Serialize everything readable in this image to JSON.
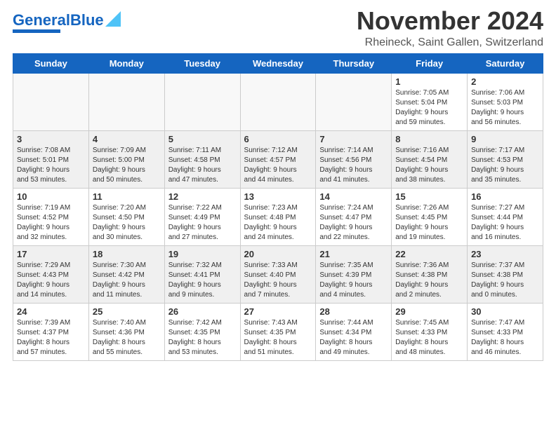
{
  "logo": {
    "text_general": "General",
    "text_blue": "Blue"
  },
  "header": {
    "month": "November 2024",
    "location": "Rheineck, Saint Gallen, Switzerland"
  },
  "weekdays": [
    "Sunday",
    "Monday",
    "Tuesday",
    "Wednesday",
    "Thursday",
    "Friday",
    "Saturday"
  ],
  "weeks": [
    [
      {
        "day": "",
        "info": "",
        "empty": true
      },
      {
        "day": "",
        "info": "",
        "empty": true
      },
      {
        "day": "",
        "info": "",
        "empty": true
      },
      {
        "day": "",
        "info": "",
        "empty": true
      },
      {
        "day": "",
        "info": "",
        "empty": true
      },
      {
        "day": "1",
        "info": "Sunrise: 7:05 AM\nSunset: 5:04 PM\nDaylight: 9 hours\nand 59 minutes."
      },
      {
        "day": "2",
        "info": "Sunrise: 7:06 AM\nSunset: 5:03 PM\nDaylight: 9 hours\nand 56 minutes."
      }
    ],
    [
      {
        "day": "3",
        "info": "Sunrise: 7:08 AM\nSunset: 5:01 PM\nDaylight: 9 hours\nand 53 minutes."
      },
      {
        "day": "4",
        "info": "Sunrise: 7:09 AM\nSunset: 5:00 PM\nDaylight: 9 hours\nand 50 minutes."
      },
      {
        "day": "5",
        "info": "Sunrise: 7:11 AM\nSunset: 4:58 PM\nDaylight: 9 hours\nand 47 minutes."
      },
      {
        "day": "6",
        "info": "Sunrise: 7:12 AM\nSunset: 4:57 PM\nDaylight: 9 hours\nand 44 minutes."
      },
      {
        "day": "7",
        "info": "Sunrise: 7:14 AM\nSunset: 4:56 PM\nDaylight: 9 hours\nand 41 minutes."
      },
      {
        "day": "8",
        "info": "Sunrise: 7:16 AM\nSunset: 4:54 PM\nDaylight: 9 hours\nand 38 minutes."
      },
      {
        "day": "9",
        "info": "Sunrise: 7:17 AM\nSunset: 4:53 PM\nDaylight: 9 hours\nand 35 minutes."
      }
    ],
    [
      {
        "day": "10",
        "info": "Sunrise: 7:19 AM\nSunset: 4:52 PM\nDaylight: 9 hours\nand 32 minutes."
      },
      {
        "day": "11",
        "info": "Sunrise: 7:20 AM\nSunset: 4:50 PM\nDaylight: 9 hours\nand 30 minutes."
      },
      {
        "day": "12",
        "info": "Sunrise: 7:22 AM\nSunset: 4:49 PM\nDaylight: 9 hours\nand 27 minutes."
      },
      {
        "day": "13",
        "info": "Sunrise: 7:23 AM\nSunset: 4:48 PM\nDaylight: 9 hours\nand 24 minutes."
      },
      {
        "day": "14",
        "info": "Sunrise: 7:24 AM\nSunset: 4:47 PM\nDaylight: 9 hours\nand 22 minutes."
      },
      {
        "day": "15",
        "info": "Sunrise: 7:26 AM\nSunset: 4:45 PM\nDaylight: 9 hours\nand 19 minutes."
      },
      {
        "day": "16",
        "info": "Sunrise: 7:27 AM\nSunset: 4:44 PM\nDaylight: 9 hours\nand 16 minutes."
      }
    ],
    [
      {
        "day": "17",
        "info": "Sunrise: 7:29 AM\nSunset: 4:43 PM\nDaylight: 9 hours\nand 14 minutes."
      },
      {
        "day": "18",
        "info": "Sunrise: 7:30 AM\nSunset: 4:42 PM\nDaylight: 9 hours\nand 11 minutes."
      },
      {
        "day": "19",
        "info": "Sunrise: 7:32 AM\nSunset: 4:41 PM\nDaylight: 9 hours\nand 9 minutes."
      },
      {
        "day": "20",
        "info": "Sunrise: 7:33 AM\nSunset: 4:40 PM\nDaylight: 9 hours\nand 7 minutes."
      },
      {
        "day": "21",
        "info": "Sunrise: 7:35 AM\nSunset: 4:39 PM\nDaylight: 9 hours\nand 4 minutes."
      },
      {
        "day": "22",
        "info": "Sunrise: 7:36 AM\nSunset: 4:38 PM\nDaylight: 9 hours\nand 2 minutes."
      },
      {
        "day": "23",
        "info": "Sunrise: 7:37 AM\nSunset: 4:38 PM\nDaylight: 9 hours\nand 0 minutes."
      }
    ],
    [
      {
        "day": "24",
        "info": "Sunrise: 7:39 AM\nSunset: 4:37 PM\nDaylight: 8 hours\nand 57 minutes."
      },
      {
        "day": "25",
        "info": "Sunrise: 7:40 AM\nSunset: 4:36 PM\nDaylight: 8 hours\nand 55 minutes."
      },
      {
        "day": "26",
        "info": "Sunrise: 7:42 AM\nSunset: 4:35 PM\nDaylight: 8 hours\nand 53 minutes."
      },
      {
        "day": "27",
        "info": "Sunrise: 7:43 AM\nSunset: 4:35 PM\nDaylight: 8 hours\nand 51 minutes."
      },
      {
        "day": "28",
        "info": "Sunrise: 7:44 AM\nSunset: 4:34 PM\nDaylight: 8 hours\nand 49 minutes."
      },
      {
        "day": "29",
        "info": "Sunrise: 7:45 AM\nSunset: 4:33 PM\nDaylight: 8 hours\nand 48 minutes."
      },
      {
        "day": "30",
        "info": "Sunrise: 7:47 AM\nSunset: 4:33 PM\nDaylight: 8 hours\nand 46 minutes."
      }
    ]
  ]
}
